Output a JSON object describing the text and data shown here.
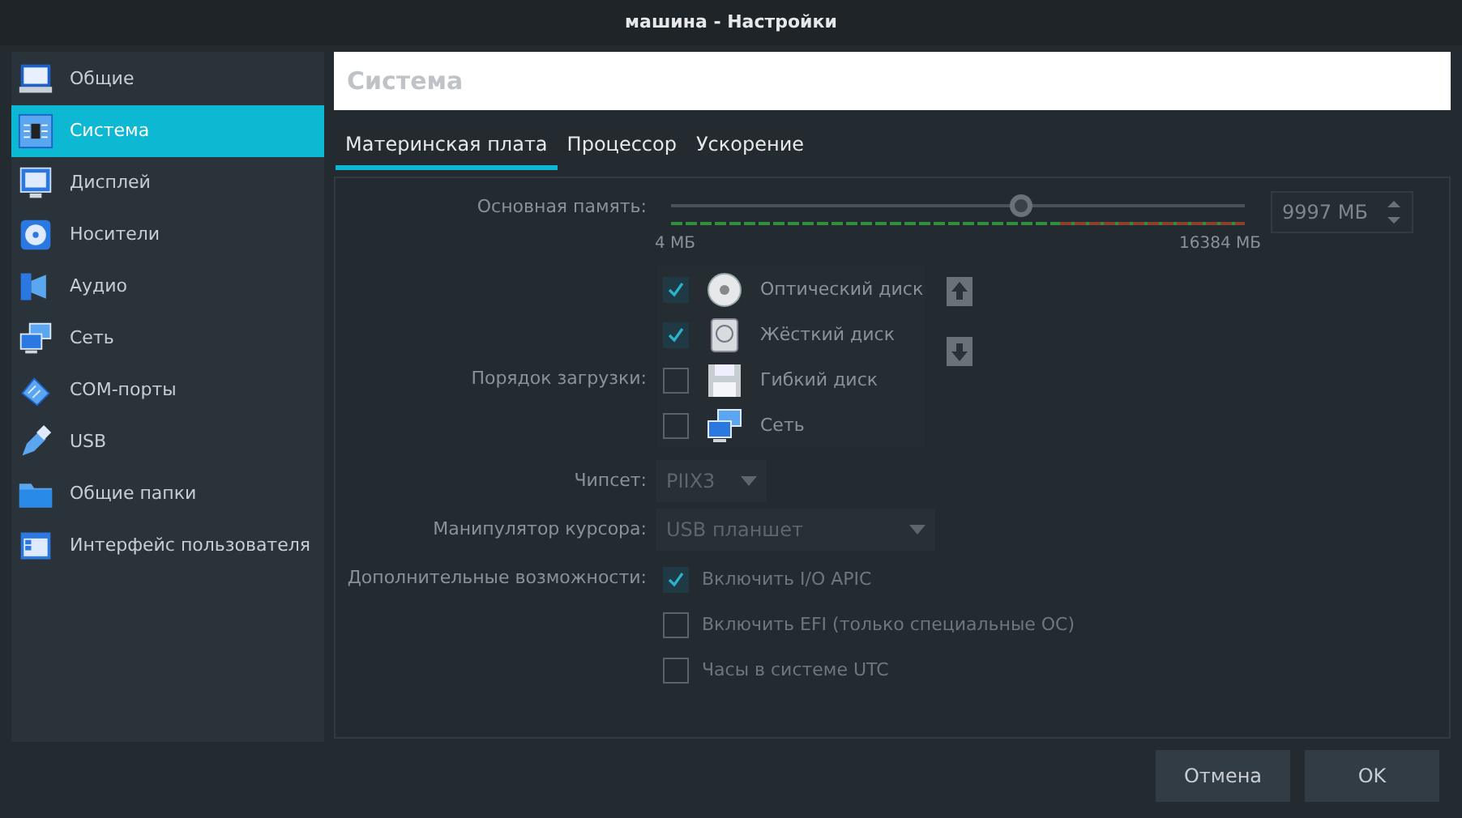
{
  "window": {
    "title": "машина - Настройки"
  },
  "sidebar": {
    "items": [
      {
        "label": "Общие",
        "kind": "laptop",
        "selected": false
      },
      {
        "label": "Система",
        "kind": "chip",
        "selected": true
      },
      {
        "label": "Дисплей",
        "kind": "monitor",
        "selected": false
      },
      {
        "label": "Носители",
        "kind": "disk",
        "selected": false
      },
      {
        "label": "Аудио",
        "kind": "speaker",
        "selected": false
      },
      {
        "label": "Сеть",
        "kind": "network",
        "selected": false
      },
      {
        "label": "COM-порты",
        "kind": "plug",
        "selected": false
      },
      {
        "label": "USB",
        "kind": "usb",
        "selected": false
      },
      {
        "label": "Общие папки",
        "kind": "folder",
        "selected": false
      },
      {
        "label": "Интерфейс пользователя",
        "kind": "window",
        "selected": false
      }
    ]
  },
  "header": {
    "title": "Система"
  },
  "tabs": [
    {
      "label": "Материнская плата",
      "selected": true
    },
    {
      "label": "Процессор",
      "selected": false
    },
    {
      "label": "Ускорение",
      "selected": false
    }
  ],
  "memory": {
    "label": "Основная память:",
    "level": 0.61,
    "min_label": "4 МБ",
    "max_label": "16384 МБ",
    "value": "9997 МБ"
  },
  "boot_order": {
    "label": "Порядок загрузки:",
    "items": [
      {
        "label": "Оптический диск",
        "kind": "disc",
        "checked": true
      },
      {
        "label": "Жёсткий диск",
        "kind": "hdd",
        "checked": true
      },
      {
        "label": "Гибкий диск",
        "kind": "floppy",
        "checked": false
      },
      {
        "label": "Сеть",
        "kind": "network",
        "checked": false
      }
    ]
  },
  "chipset": {
    "label": "Чипсет:",
    "value": "PIIX3"
  },
  "pointing_device": {
    "label": "Манипулятор курсора:",
    "value": "USB планшет"
  },
  "features": {
    "label": "Дополнительные возможности:",
    "items": [
      {
        "label": "Включить I/O APIC",
        "checked": true
      },
      {
        "label": "Включить EFI (только специальные ОС)",
        "checked": false
      },
      {
        "label": "Часы в системе UTC",
        "checked": false
      }
    ]
  },
  "buttons": [
    "Отмена",
    "OK"
  ]
}
